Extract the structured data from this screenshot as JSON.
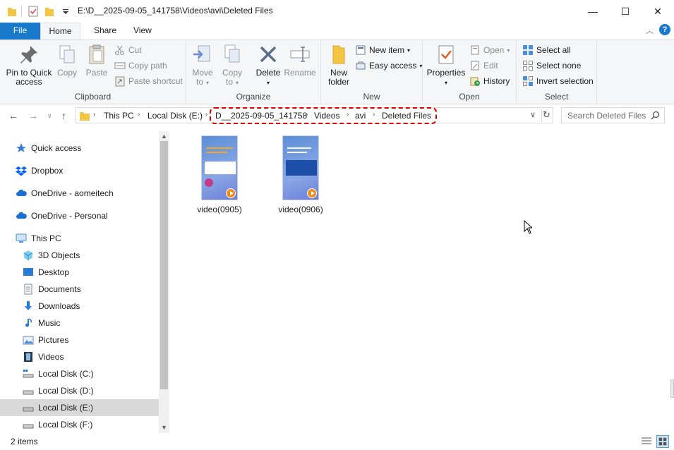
{
  "window": {
    "title": "E:\\D__2025-09-05_141758\\Videos\\avi\\Deleted Files",
    "minimize_glyph": "—",
    "maximize_glyph": "☐",
    "close_glyph": "✕"
  },
  "ribbon_tabs": {
    "file": "File",
    "home": "Home",
    "share": "Share",
    "view": "View",
    "help": "?"
  },
  "ribbon": {
    "clipboard": {
      "label": "Clipboard",
      "pin_line1": "Pin to Quick",
      "pin_line2": "access",
      "copy": "Copy",
      "paste": "Paste",
      "cut": "Cut",
      "copy_path": "Copy path",
      "paste_shortcut": "Paste shortcut"
    },
    "organize": {
      "label": "Organize",
      "move_line1": "Move",
      "move_line2": "to",
      "copy_line1": "Copy",
      "copy_line2": "to",
      "delete": "Delete",
      "rename": "Rename"
    },
    "new": {
      "label": "New",
      "folder_line1": "New",
      "folder_line2": "folder",
      "new_item": "New item",
      "easy_access": "Easy access"
    },
    "open": {
      "label": "Open",
      "properties": "Properties",
      "open": "Open",
      "edit": "Edit",
      "history": "History"
    },
    "select": {
      "label": "Select",
      "select_all": "Select all",
      "select_none": "Select none",
      "invert": "Invert selection"
    }
  },
  "address": {
    "crumbs": [
      "This PC",
      "Local Disk (E:)",
      "D__2025-09-05_141758",
      "Videos",
      "avi",
      "Deleted Files"
    ],
    "search_placeholder": "Search Deleted Files"
  },
  "nav": {
    "items": [
      {
        "label": "Quick access",
        "icon": "star-icon"
      },
      {
        "label": "Dropbox",
        "icon": "dropbox-icon"
      },
      {
        "label": "OneDrive - aomeitech",
        "icon": "cloud-icon"
      },
      {
        "label": "OneDrive - Personal",
        "icon": "cloud-icon"
      },
      {
        "label": "This PC",
        "icon": "computer-icon"
      },
      {
        "label": "3D Objects",
        "icon": "cube-icon"
      },
      {
        "label": "Desktop",
        "icon": "desktop-icon"
      },
      {
        "label": "Documents",
        "icon": "document-icon"
      },
      {
        "label": "Downloads",
        "icon": "download-icon"
      },
      {
        "label": "Music",
        "icon": "music-icon"
      },
      {
        "label": "Pictures",
        "icon": "picture-icon"
      },
      {
        "label": "Videos",
        "icon": "film-icon"
      },
      {
        "label": "Local Disk (C:)",
        "icon": "drive-icon"
      },
      {
        "label": "Local Disk (D:)",
        "icon": "drive-icon"
      },
      {
        "label": "Local Disk (E:)",
        "icon": "drive-icon",
        "selected": true
      },
      {
        "label": "Local Disk (F:)",
        "icon": "drive-icon"
      }
    ]
  },
  "files": [
    {
      "name": "video(0905)"
    },
    {
      "name": "video(0906)"
    }
  ],
  "status": {
    "count": "2 items"
  },
  "colors": {
    "accent": "#1979ca",
    "highlight": "#e00000",
    "folder": "#f4c542"
  }
}
